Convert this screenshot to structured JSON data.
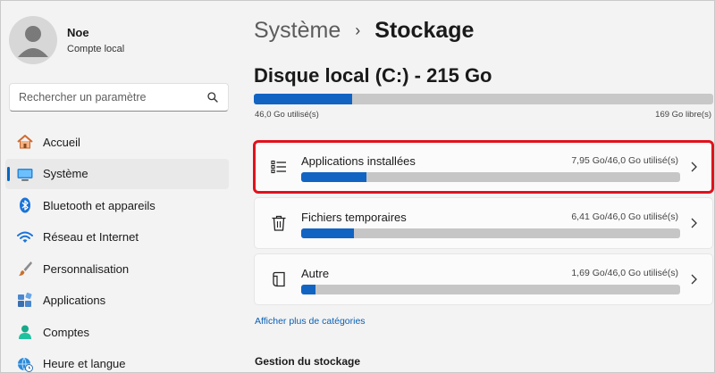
{
  "profile": {
    "name": "Noe",
    "account_type": "Compte local"
  },
  "search": {
    "placeholder": "Rechercher un paramètre"
  },
  "sidebar": {
    "items": [
      {
        "label": "Accueil",
        "icon": "home-icon"
      },
      {
        "label": "Système",
        "icon": "system-icon",
        "active": true
      },
      {
        "label": "Bluetooth et appareils",
        "icon": "bluetooth-icon"
      },
      {
        "label": "Réseau et Internet",
        "icon": "wifi-icon"
      },
      {
        "label": "Personnalisation",
        "icon": "brush-icon"
      },
      {
        "label": "Applications",
        "icon": "apps-icon"
      },
      {
        "label": "Comptes",
        "icon": "account-icon"
      },
      {
        "label": "Heure et langue",
        "icon": "globe-clock-icon"
      }
    ]
  },
  "breadcrumb": {
    "parent": "Système",
    "separator": "›",
    "current": "Stockage"
  },
  "disk": {
    "title": "Disque local (C:) - 215 Go",
    "used_label": "46,0 Go utilisé(s)",
    "free_label": "169 Go libre(s)",
    "used_fraction": 0.214
  },
  "categories": [
    {
      "title": "Applications installées",
      "usage": "7,95 Go/46,0 Go utilisé(s)",
      "fraction": 0.173,
      "icon": "list-icon",
      "highlighted": true
    },
    {
      "title": "Fichiers temporaires",
      "usage": "6,41 Go/46,0 Go utilisé(s)",
      "fraction": 0.139,
      "icon": "trash-icon",
      "highlighted": false
    },
    {
      "title": "Autre",
      "usage": "1,69 Go/46,0 Go utilisé(s)",
      "fraction": 0.037,
      "icon": "document-icon",
      "highlighted": false
    }
  ],
  "more_link": "Afficher plus de catégories",
  "storage_management": {
    "title": "Gestion du stockage"
  },
  "colors": {
    "accent": "#0067c0",
    "bar_fill": "#1264c3",
    "highlight": "#e0121c"
  }
}
